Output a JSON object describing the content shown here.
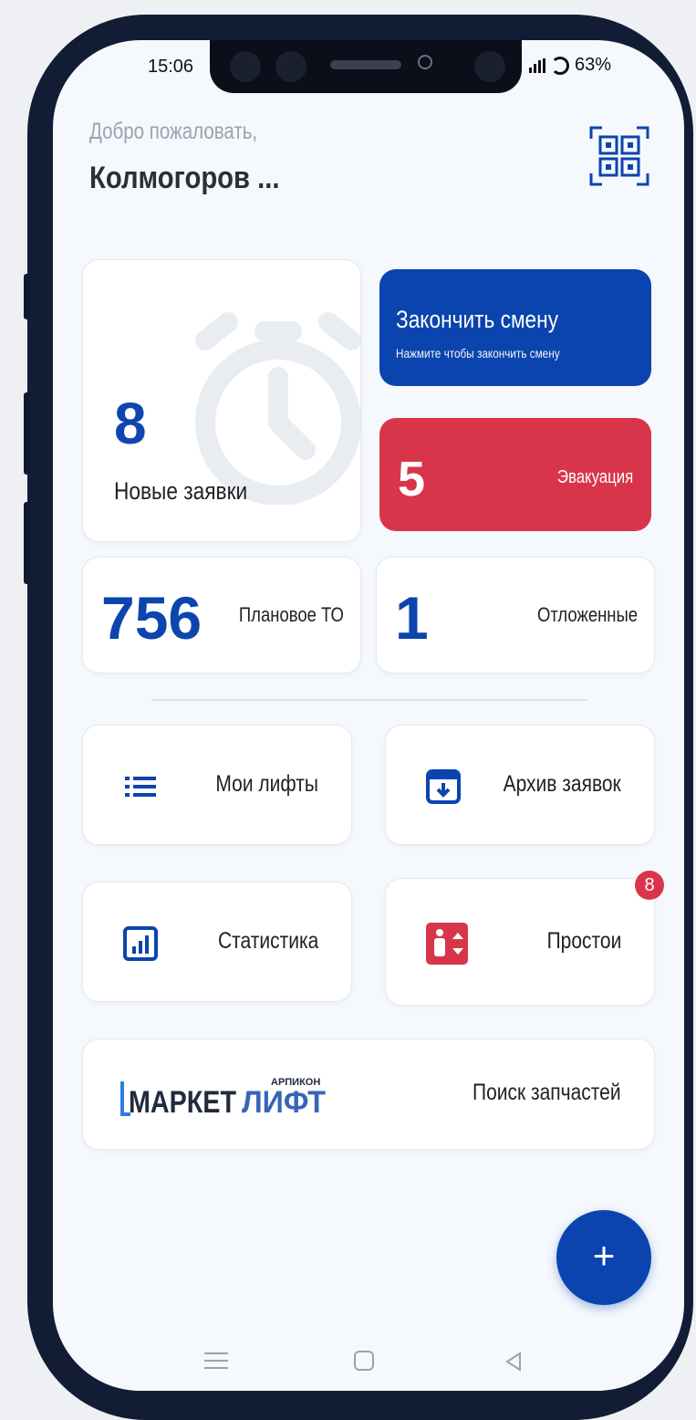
{
  "status_bar": {
    "time": "15:06",
    "battery": "63%"
  },
  "header": {
    "welcome": "Добро пожаловать,",
    "user_name": "Колмогоров ..."
  },
  "new_requests": {
    "count": "8",
    "label": "Новые заявки"
  },
  "end_shift": {
    "title": "Закончить смену",
    "subtitle": "Нажмите чтобы закончить смену"
  },
  "evacuation": {
    "count": "5",
    "label": "Эвакуация"
  },
  "planned_maintenance": {
    "count": "756",
    "label": "Плановое ТО"
  },
  "postponed": {
    "count": "1",
    "label": "Отложенные"
  },
  "menu": {
    "my_lifts": "Мои лифты",
    "archive": "Архив заявок",
    "statistics": "Статистика",
    "downtime": "Простои",
    "downtime_badge": "8"
  },
  "market": {
    "logo_small": "АРПИКОН",
    "logo_left": "МАРКЕТ",
    "logo_right": "ЛИФТ",
    "label": "Поиск запчастей"
  },
  "fab": {
    "symbol": "+"
  },
  "colors": {
    "primary": "#0b44ae",
    "danger": "#d9354a",
    "background": "#f5f8fc"
  }
}
